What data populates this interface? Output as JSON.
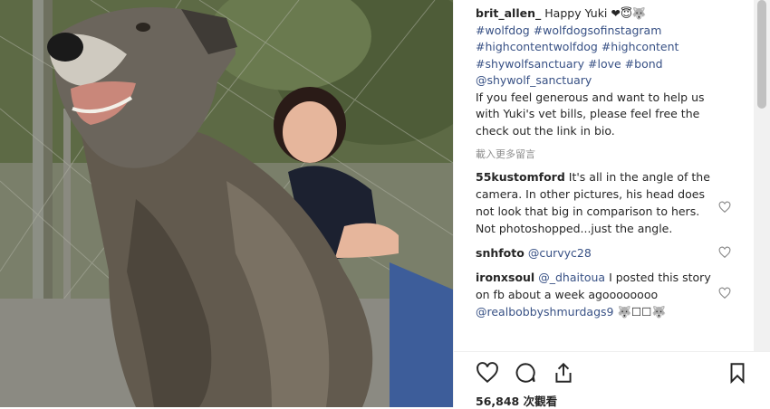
{
  "post": {
    "username": "brit_allen_",
    "caption_text": "Happy Yuki ❤😇🐺",
    "hashtags": [
      "#wolfdog #wolfdogsofinstagram",
      "#highcontentwolfdog #highcontent",
      "#shywolfsanctuary #love #bond",
      "@shywolf_sanctuary"
    ],
    "caption_body": "If you feel generous and want to help us with Yuki's vet bills, please feel free the check out the link in bio.",
    "load_more": "載入更多留言"
  },
  "comments": [
    {
      "username": "55kustomford",
      "text": "It's all in the angle of the camera. In other pictures, his head does not look that big in comparison to hers. Not photoshopped...just the angle."
    },
    {
      "username": "snhfoto",
      "mention": "@curvyc28",
      "text": ""
    },
    {
      "username": "ironxsoul",
      "mention": "@_dhaitoua",
      "text": "I posted this story on fb about a week agoooooooo",
      "mention2": "@realbobbyshmurdags9",
      "tail": "🐺☐☐🐺"
    }
  ],
  "actions": {
    "views": "56,848 次觀看"
  },
  "colors": {
    "link": "#385185",
    "text": "#262626",
    "muted": "#8e8e8e"
  }
}
